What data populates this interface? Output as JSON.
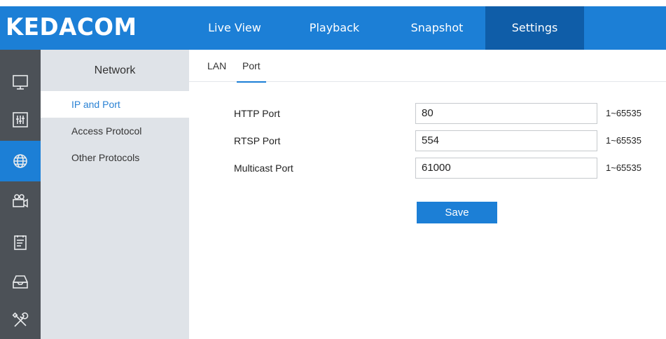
{
  "brand": {
    "logo": "KEDACOM"
  },
  "topnav": {
    "tabs": [
      {
        "label": "Live View"
      },
      {
        "label": "Playback"
      },
      {
        "label": "Snapshot"
      },
      {
        "label": "Settings"
      }
    ],
    "active": "Settings"
  },
  "iconbar": {
    "icons": [
      "monitor-icon",
      "sliders-icon",
      "network-globe-icon",
      "camera-icon",
      "event-list-icon",
      "storage-tray-icon",
      "tools-icon"
    ],
    "active": "network-globe-icon"
  },
  "subnav": {
    "header": "Network",
    "items": [
      {
        "label": "IP and Port"
      },
      {
        "label": "Access Protocol"
      },
      {
        "label": "Other Protocols"
      }
    ],
    "active": "IP and Port"
  },
  "tabs": {
    "items": [
      {
        "label": "LAN"
      },
      {
        "label": "Port"
      }
    ],
    "active": "Port"
  },
  "form": {
    "rows": [
      {
        "label": "HTTP Port",
        "value": "80",
        "range": "1~65535"
      },
      {
        "label": "RTSP Port",
        "value": "554",
        "range": "1~65535"
      },
      {
        "label": "Multicast Port",
        "value": "61000",
        "range": "1~65535"
      }
    ],
    "save_label": "Save"
  },
  "colors": {
    "primary_blue": "#1c7fd6",
    "active_nav_dark_blue": "#0f5da8",
    "icon_sidebar": "#4c5157",
    "submenu_bg": "#dfe3e8",
    "active_link": "#2a82d4"
  }
}
